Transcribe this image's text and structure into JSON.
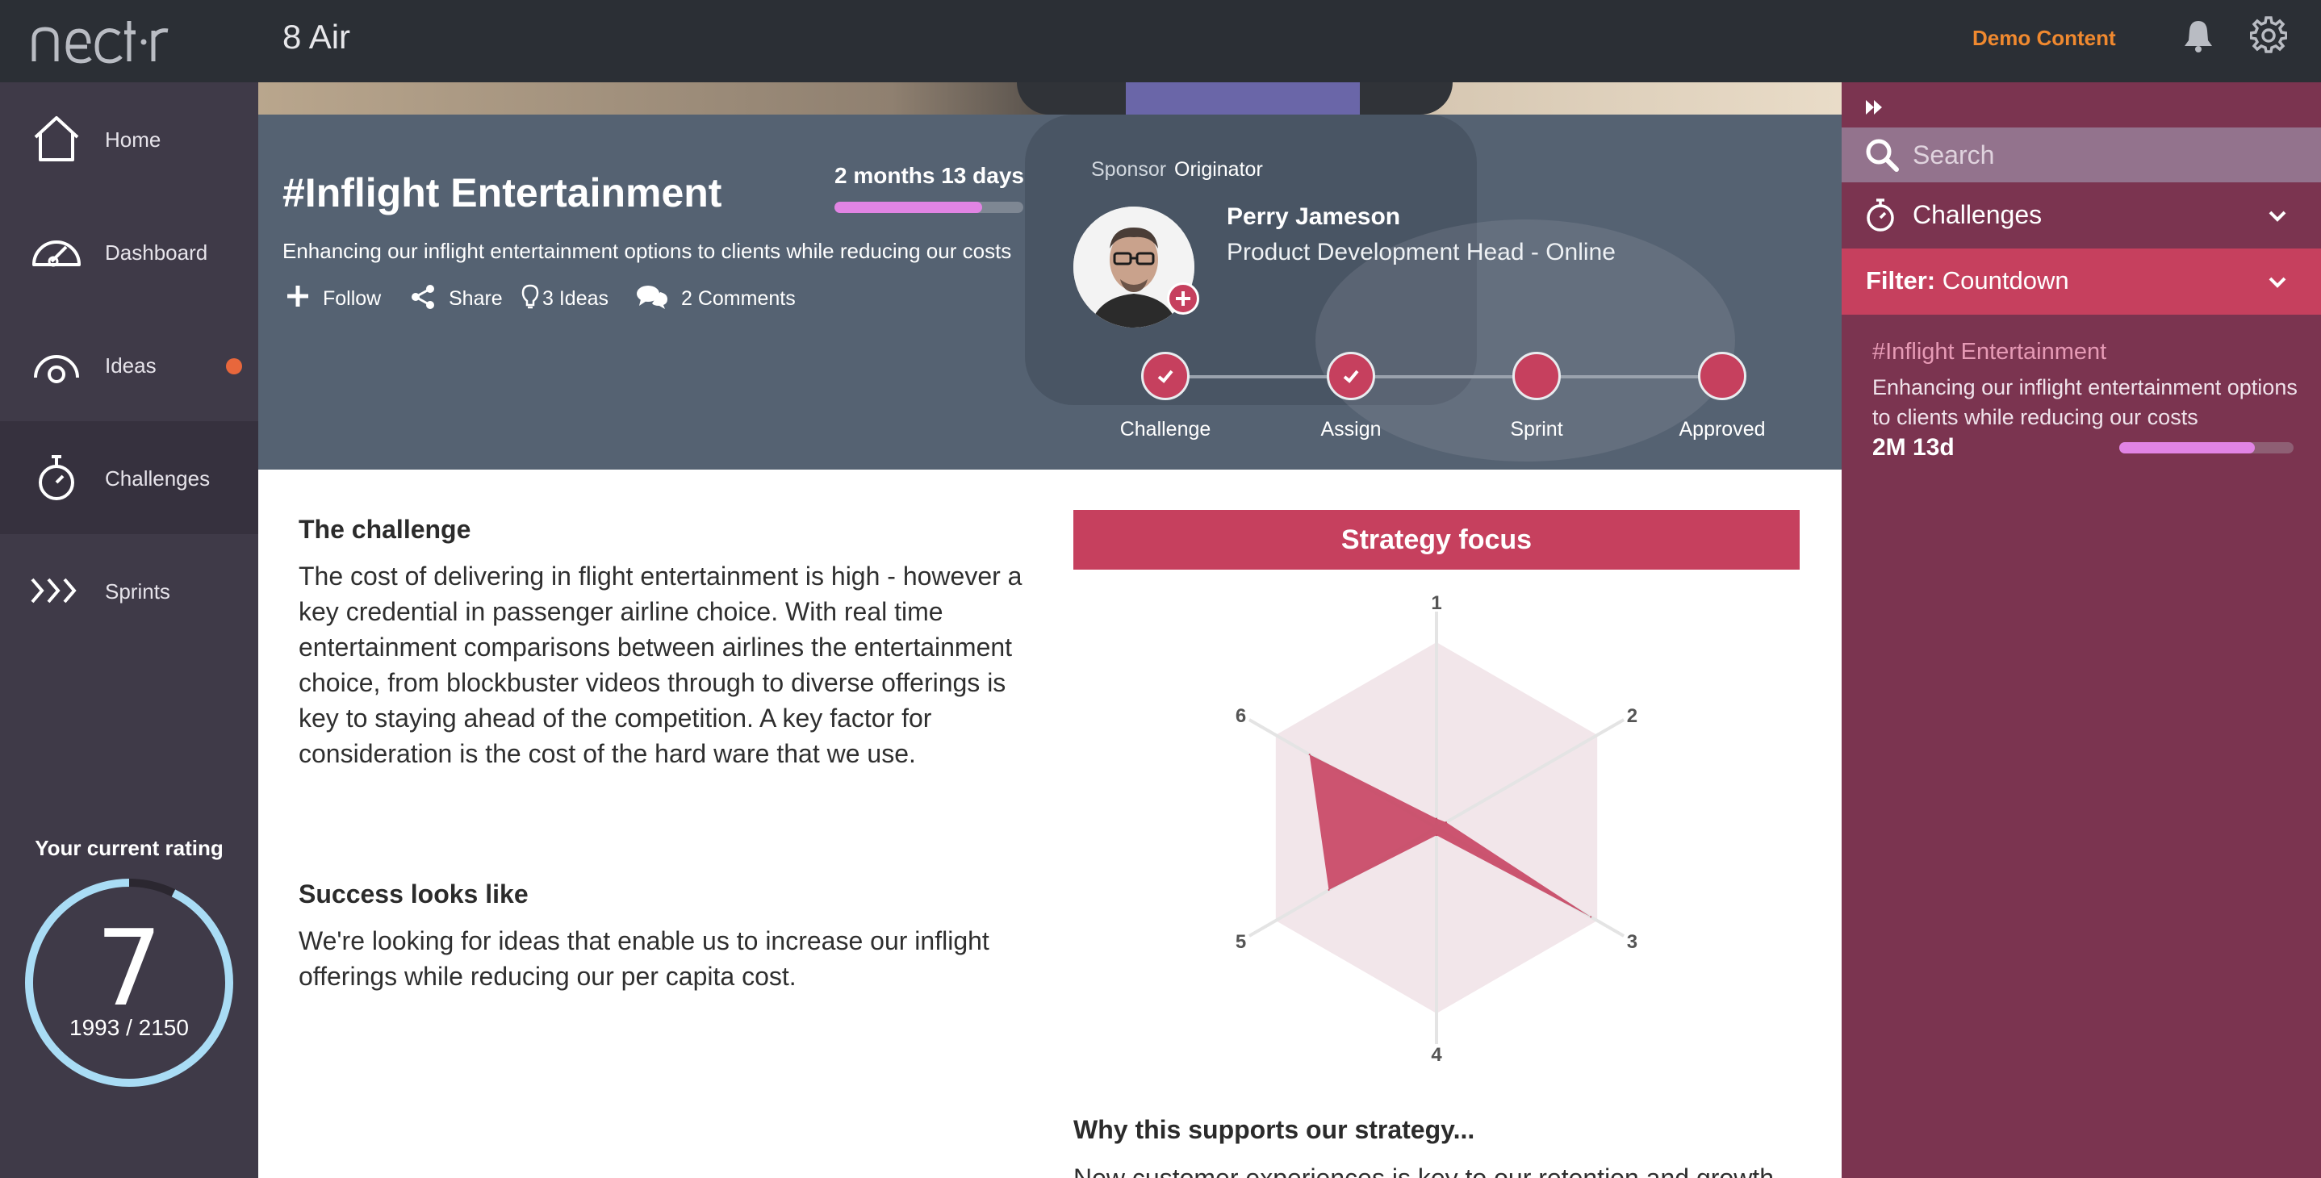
{
  "header": {
    "app_title": "8 Air",
    "demo_label": "Demo Content",
    "logo_text": "nectir"
  },
  "sidebar": {
    "items": [
      {
        "label": "Home",
        "icon": "home-icon"
      },
      {
        "label": "Dashboard",
        "icon": "dashboard-icon"
      },
      {
        "label": "Ideas",
        "icon": "ideas-icon",
        "badge": true
      },
      {
        "label": "Challenges",
        "icon": "timer-icon",
        "active": true
      },
      {
        "label": "Sprints",
        "icon": "chevrons-right-icon"
      }
    ],
    "rating": {
      "title": "Your current rating",
      "value": "7",
      "points": "1993 / 2150",
      "progress": 0.927
    }
  },
  "challenge": {
    "title": "#Inflight Entertainment",
    "countdown": "2 months 13 days",
    "countdown_progress": 0.78,
    "description": "Enhancing our inflight entertainment options to clients while reducing our costs",
    "actions": {
      "follow": "Follow",
      "share": "Share",
      "ideas": "3 Ideas",
      "comments": "2 Comments"
    },
    "sponsor_label": "Sponsor",
    "originator_label": "Originator",
    "person": {
      "name": "Perry Jameson",
      "role": "Product Development Head - Online"
    },
    "stages": [
      {
        "label": "Challenge",
        "done": true
      },
      {
        "label": "Assign",
        "done": true
      },
      {
        "label": "Sprint",
        "done": false
      },
      {
        "label": "Approved",
        "done": false
      }
    ]
  },
  "body": {
    "challenge_heading": "The challenge",
    "challenge_text": "The cost of delivering in flight entertainment is high - however a key credential in passenger airline choice. With real time entertainment comparisons between airlines the entertainment choice, from blockbuster videos through to diverse offerings is key to staying ahead of the competition. A key factor for consideration is the cost of the hard ware that we use.",
    "success_heading": "Success looks like",
    "success_text": "We're looking for ideas that enable us to increase our inflight offerings while reducing our per capita cost.",
    "strategy_title": "Strategy focus",
    "why_heading": "Why this supports our strategy...",
    "why_text": "New customer experiences is key to our retention and growth"
  },
  "chart_data": {
    "type": "radar",
    "axes": [
      "1",
      "2",
      "3",
      "4",
      "5",
      "6"
    ],
    "max": 1,
    "values": [
      0.05,
      0.06,
      0.96,
      0.04,
      0.67,
      0.79
    ],
    "series_color": "#c6405e",
    "background_color": "#f2e6ea"
  },
  "right_panel": {
    "search_placeholder": "Search",
    "challenges_label": "Challenges",
    "filter_label": "Filter:",
    "filter_value": "Countdown",
    "item": {
      "title": "#Inflight Entertainment",
      "description": "Enhancing our inflight entertainment options to clients while reducing our costs",
      "countdown": "2M 13d",
      "progress": 0.78
    }
  },
  "colors": {
    "topbar": "#2b2f35",
    "sidebar": "#3f3a48",
    "accent": "#c6405e",
    "right_panel": "#7b3450",
    "demo": "#f0892f",
    "progress": "#e184e4"
  }
}
